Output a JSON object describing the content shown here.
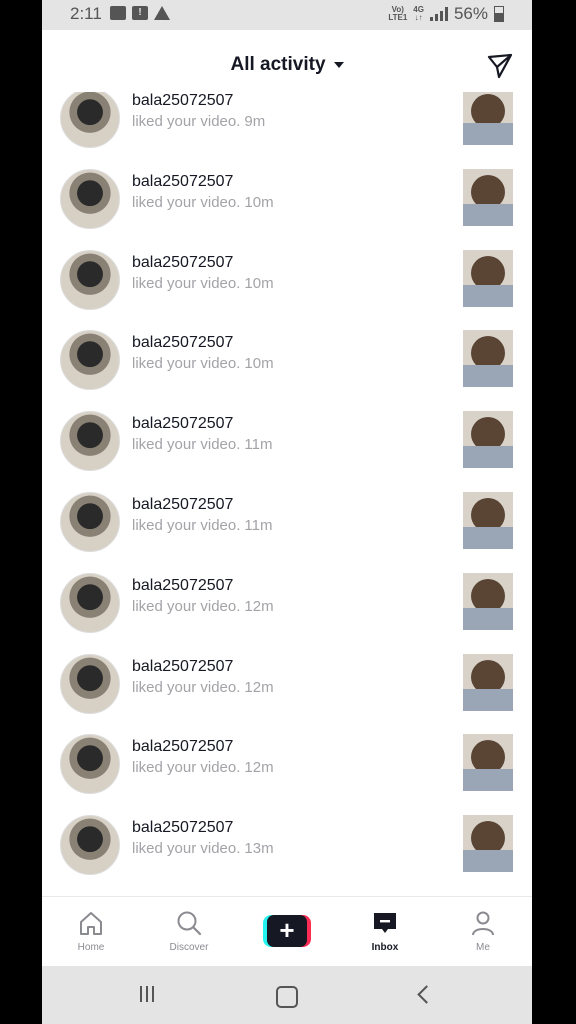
{
  "status_bar": {
    "time": "2:11",
    "network_top": "Vo)",
    "network_bottom": "LTE1",
    "network_type_top": "4G",
    "network_type_bottom": "↓↑",
    "battery": "56%"
  },
  "header": {
    "title": "All activity",
    "send_icon": "send-icon"
  },
  "notifications": [
    {
      "username": "bala25072507",
      "action": "liked your video.",
      "time": "9m"
    },
    {
      "username": "bala25072507",
      "action": "liked your video.",
      "time": "10m"
    },
    {
      "username": "bala25072507",
      "action": "liked your video.",
      "time": "10m"
    },
    {
      "username": "bala25072507",
      "action": "liked your video.",
      "time": "10m"
    },
    {
      "username": "bala25072507",
      "action": "liked your video.",
      "time": "11m"
    },
    {
      "username": "bala25072507",
      "action": "liked your video.",
      "time": "11m"
    },
    {
      "username": "bala25072507",
      "action": "liked your video.",
      "time": "12m"
    },
    {
      "username": "bala25072507",
      "action": "liked your video.",
      "time": "12m"
    },
    {
      "username": "bala25072507",
      "action": "liked your video.",
      "time": "12m"
    },
    {
      "username": "bala25072507",
      "action": "liked your video.",
      "time": "13m"
    }
  ],
  "bottom_nav": {
    "home": "Home",
    "discover": "Discover",
    "create": "+",
    "inbox": "Inbox",
    "me": "Me",
    "active": "inbox"
  },
  "colors": {
    "text_primary": "#161823",
    "text_secondary": "#a3a3a8",
    "accent_cyan": "#25f4ee",
    "accent_pink": "#fe2c55"
  }
}
